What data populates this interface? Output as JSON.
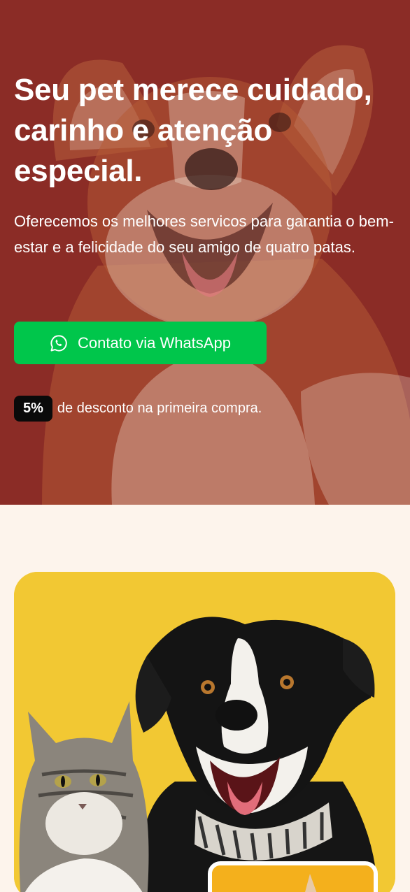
{
  "hero": {
    "title": "Seu pet merece cuidado, carinho e atenção especial.",
    "subtitle": "Oferecemos os melhores servicos para garantia o bem-estar e a felicidade do seu amigo de quatro patas.",
    "cta_label": "Contato via WhatsApp",
    "cta_icon": "whatsapp-icon",
    "discount_badge": "5%",
    "discount_text": "de desconto na primeira compra.",
    "background_color": "#8b2c26",
    "cta_color": "#00c64b"
  },
  "section2": {
    "background_color": "#fdf4ec",
    "card_color": "#f2c833"
  }
}
